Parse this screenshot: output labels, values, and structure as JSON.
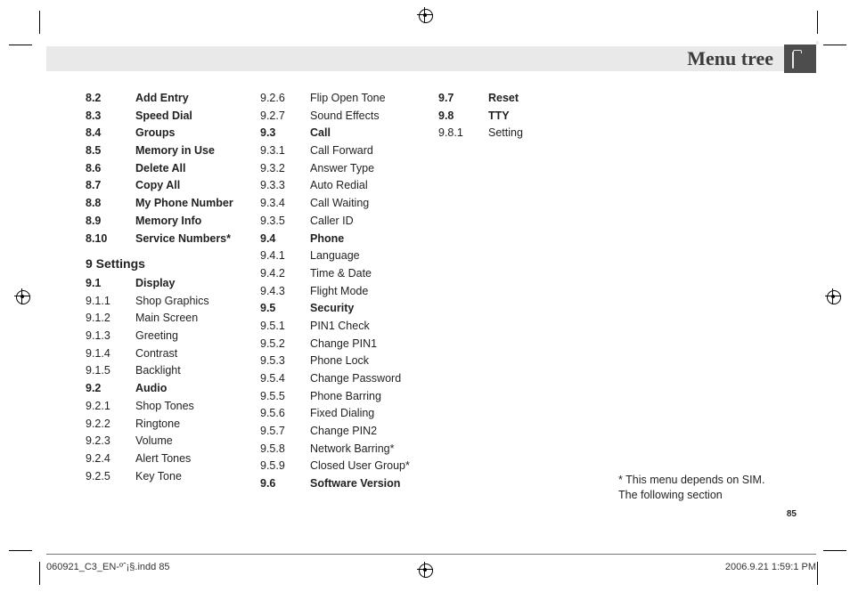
{
  "header": {
    "title": "Menu tree"
  },
  "col1": {
    "top": [
      {
        "num": "8.2",
        "label": "Add Entry",
        "bold": true
      },
      {
        "num": "8.3",
        "label": "Speed Dial",
        "bold": true
      },
      {
        "num": "8.4",
        "label": "Groups",
        "bold": true
      },
      {
        "num": "8.5",
        "label": "Memory in Use",
        "bold": true
      },
      {
        "num": "8.6",
        "label": "Delete All",
        "bold": true
      },
      {
        "num": "8.7",
        "label": "Copy All",
        "bold": true
      },
      {
        "num": "8.8",
        "label": "My Phone Number",
        "bold": true
      },
      {
        "num": "8.9",
        "label": "Memory Info",
        "bold": true
      },
      {
        "num": "8.10",
        "label": "Service Numbers*",
        "bold": true
      }
    ],
    "sectionHeading": "9 Settings",
    "bottom": [
      {
        "num": "9.1",
        "label": "Display",
        "bold": true
      },
      {
        "num": "9.1.1",
        "label": "Shop Graphics",
        "bold": false
      },
      {
        "num": "9.1.2",
        "label": "Main Screen",
        "bold": false
      },
      {
        "num": "9.1.3",
        "label": "Greeting",
        "bold": false
      },
      {
        "num": "9.1.4",
        "label": "Contrast",
        "bold": false
      },
      {
        "num": "9.1.5",
        "label": "Backlight",
        "bold": false
      },
      {
        "num": "9.2",
        "label": "Audio",
        "bold": true
      },
      {
        "num": "9.2.1",
        "label": "Shop Tones",
        "bold": false
      },
      {
        "num": "9.2.2",
        "label": "Ringtone",
        "bold": false
      },
      {
        "num": "9.2.3",
        "label": "Volume",
        "bold": false
      },
      {
        "num": "9.2.4",
        "label": "Alert Tones",
        "bold": false
      },
      {
        "num": "9.2.5",
        "label": "Key Tone",
        "bold": false
      }
    ]
  },
  "col2": [
    {
      "num": "9.2.6",
      "label": "Flip Open Tone",
      "bold": false
    },
    {
      "num": "9.2.7",
      "label": "Sound Effects",
      "bold": false
    },
    {
      "num": "9.3",
      "label": "Call",
      "bold": true
    },
    {
      "num": "9.3.1",
      "label": "Call Forward",
      "bold": false
    },
    {
      "num": "9.3.2",
      "label": "Answer Type",
      "bold": false
    },
    {
      "num": "9.3.3",
      "label": "Auto Redial",
      "bold": false
    },
    {
      "num": "9.3.4",
      "label": "Call Waiting",
      "bold": false
    },
    {
      "num": "9.3.5",
      "label": "Caller ID",
      "bold": false
    },
    {
      "num": "9.4",
      "label": "Phone",
      "bold": true
    },
    {
      "num": "9.4.1",
      "label": "Language",
      "bold": false
    },
    {
      "num": "9.4.2",
      "label": "Time & Date",
      "bold": false
    },
    {
      "num": "9.4.3",
      "label": "Flight Mode",
      "bold": false
    },
    {
      "num": "9.5",
      "label": "Security",
      "bold": true
    },
    {
      "num": "9.5.1",
      "label": "PIN1 Check",
      "bold": false
    },
    {
      "num": "9.5.2",
      "label": "Change PIN1",
      "bold": false
    },
    {
      "num": "9.5.3",
      "label": "Phone Lock",
      "bold": false
    },
    {
      "num": "9.5.4",
      "label": "Change Password",
      "bold": false
    },
    {
      "num": "9.5.5",
      "label": "Phone Barring",
      "bold": false
    },
    {
      "num": "9.5.6",
      "label": "Fixed Dialing",
      "bold": false
    },
    {
      "num": "9.5.7",
      "label": "Change PIN2",
      "bold": false
    },
    {
      "num": "9.5.8",
      "label": "Network Barring*",
      "bold": false
    },
    {
      "num": "9.5.9",
      "label": "Closed User Group*",
      "bold": false
    },
    {
      "num": "9.6",
      "label": "Software Version",
      "bold": true
    }
  ],
  "col3": [
    {
      "num": "9.7",
      "label": "Reset",
      "bold": true
    },
    {
      "num": "9.8",
      "label": "TTY",
      "bold": true
    },
    {
      "num": "9.8.1",
      "label": "Setting",
      "bold": false
    }
  ],
  "footnote": {
    "line1": "* This menu depends on SIM.",
    "line2": "The following section"
  },
  "pageNumber": "85",
  "footer": {
    "left": "060921_C3_EN-ºˆ¡§.indd   85",
    "right": "2006.9.21   1:59:1 PM"
  }
}
